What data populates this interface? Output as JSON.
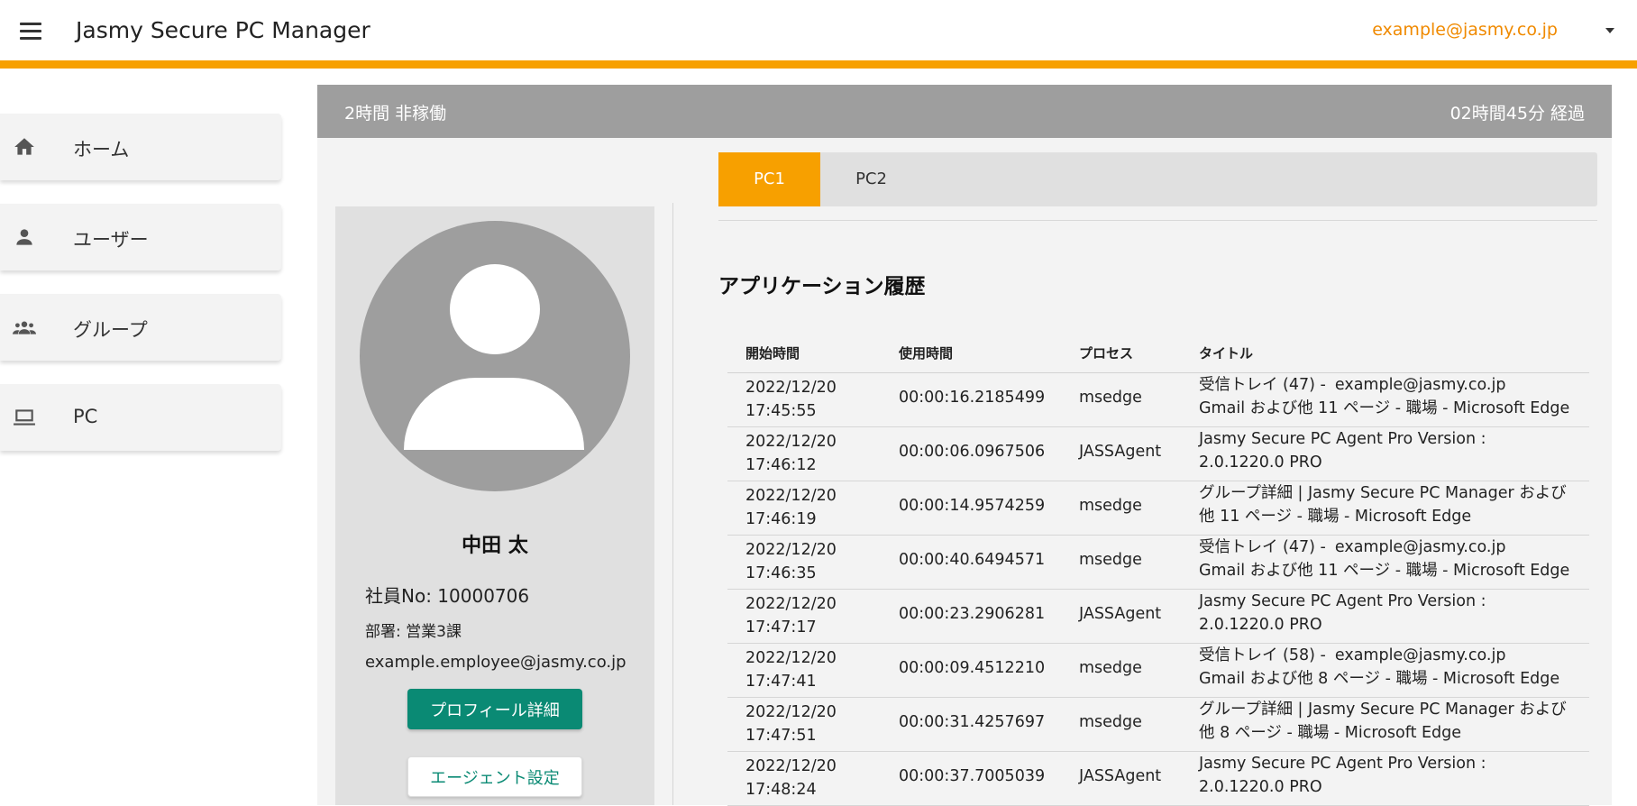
{
  "app": {
    "title": "Jasmy Secure PC Manager",
    "account_email": "example@jasmy.co.jp"
  },
  "colors": {
    "accent": "#f7a000",
    "primary_button": "#0a8a74",
    "status_bar": "#9e9e9e"
  },
  "sidebar": {
    "items": [
      {
        "label": "ホーム",
        "icon": "home-icon"
      },
      {
        "label": "ユーザー",
        "icon": "person-icon"
      },
      {
        "label": "グループ",
        "icon": "group-icon"
      },
      {
        "label": "PC",
        "icon": "laptop-icon"
      }
    ]
  },
  "status": {
    "left": "2時間 非稼働",
    "right": "02時間45分 経過"
  },
  "profile": {
    "name": "中田 太",
    "employee_no": "社員No: 10000706",
    "department": "部署: 営業3課",
    "email": "example.employee@jasmy.co.jp",
    "detail_button": "プロフィール詳細",
    "agent_button": "エージェント設定"
  },
  "tabs": [
    {
      "label": "PC1",
      "active": true
    },
    {
      "label": "PC2",
      "active": false
    }
  ],
  "history": {
    "title": "アプリケーション履歴",
    "columns": [
      "開始時間",
      "使用時間",
      "プロセス",
      "タイトル"
    ],
    "rows": [
      {
        "date": "2022/12/20",
        "time": "17:45:55",
        "duration": "00:00:16.2185499",
        "process": "msedge",
        "title_line1": "受信トレイ (47) -",
        "title_email": "example@jasmy.co.jp",
        "title_line2": "Gmail および他 11 ページ - 職場 - Microsoft Edge"
      },
      {
        "date": "2022/12/20",
        "time": "17:46:12",
        "duration": "00:00:06.0967506",
        "process": "JASSAgent",
        "title_line1": "Jasmy Secure PC Agent Pro Version :",
        "title_email": "",
        "title_line2": "2.0.1220.0 PRO"
      },
      {
        "date": "2022/12/20",
        "time": "17:46:19",
        "duration": "00:00:14.9574259",
        "process": "msedge",
        "title_line1": "グループ詳細 | Jasmy Secure PC Manager および",
        "title_email": "",
        "title_line2": "他 11 ページ - 職場 - Microsoft Edge"
      },
      {
        "date": "2022/12/20",
        "time": "17:46:35",
        "duration": "00:00:40.6494571",
        "process": "msedge",
        "title_line1": "受信トレイ (47) -",
        "title_email": "example@jasmy.co.jp",
        "title_line2": "Gmail および他 11 ページ - 職場 - Microsoft Edge"
      },
      {
        "date": "2022/12/20",
        "time": "17:47:17",
        "duration": "00:00:23.2906281",
        "process": "JASSAgent",
        "title_line1": "Jasmy Secure PC Agent Pro Version :",
        "title_email": "",
        "title_line2": "2.0.1220.0 PRO"
      },
      {
        "date": "2022/12/20",
        "time": "17:47:41",
        "duration": "00:00:09.4512210",
        "process": "msedge",
        "title_line1": "受信トレイ (58) -",
        "title_email": "example@jasmy.co.jp",
        "title_line2": "Gmail および他 8 ページ - 職場 - Microsoft Edge"
      },
      {
        "date": "2022/12/20",
        "time": "17:47:51",
        "duration": "00:00:31.4257697",
        "process": "msedge",
        "title_line1": "グループ詳細 | Jasmy Secure PC Manager および",
        "title_email": "",
        "title_line2": "他 8 ページ - 職場 - Microsoft Edge"
      },
      {
        "date": "2022/12/20",
        "time": "17:48:24",
        "duration": "00:00:37.7005039",
        "process": "JASSAgent",
        "title_line1": "Jasmy Secure PC Agent Pro Version :",
        "title_email": "",
        "title_line2": "2.0.1220.0 PRO"
      }
    ]
  }
}
